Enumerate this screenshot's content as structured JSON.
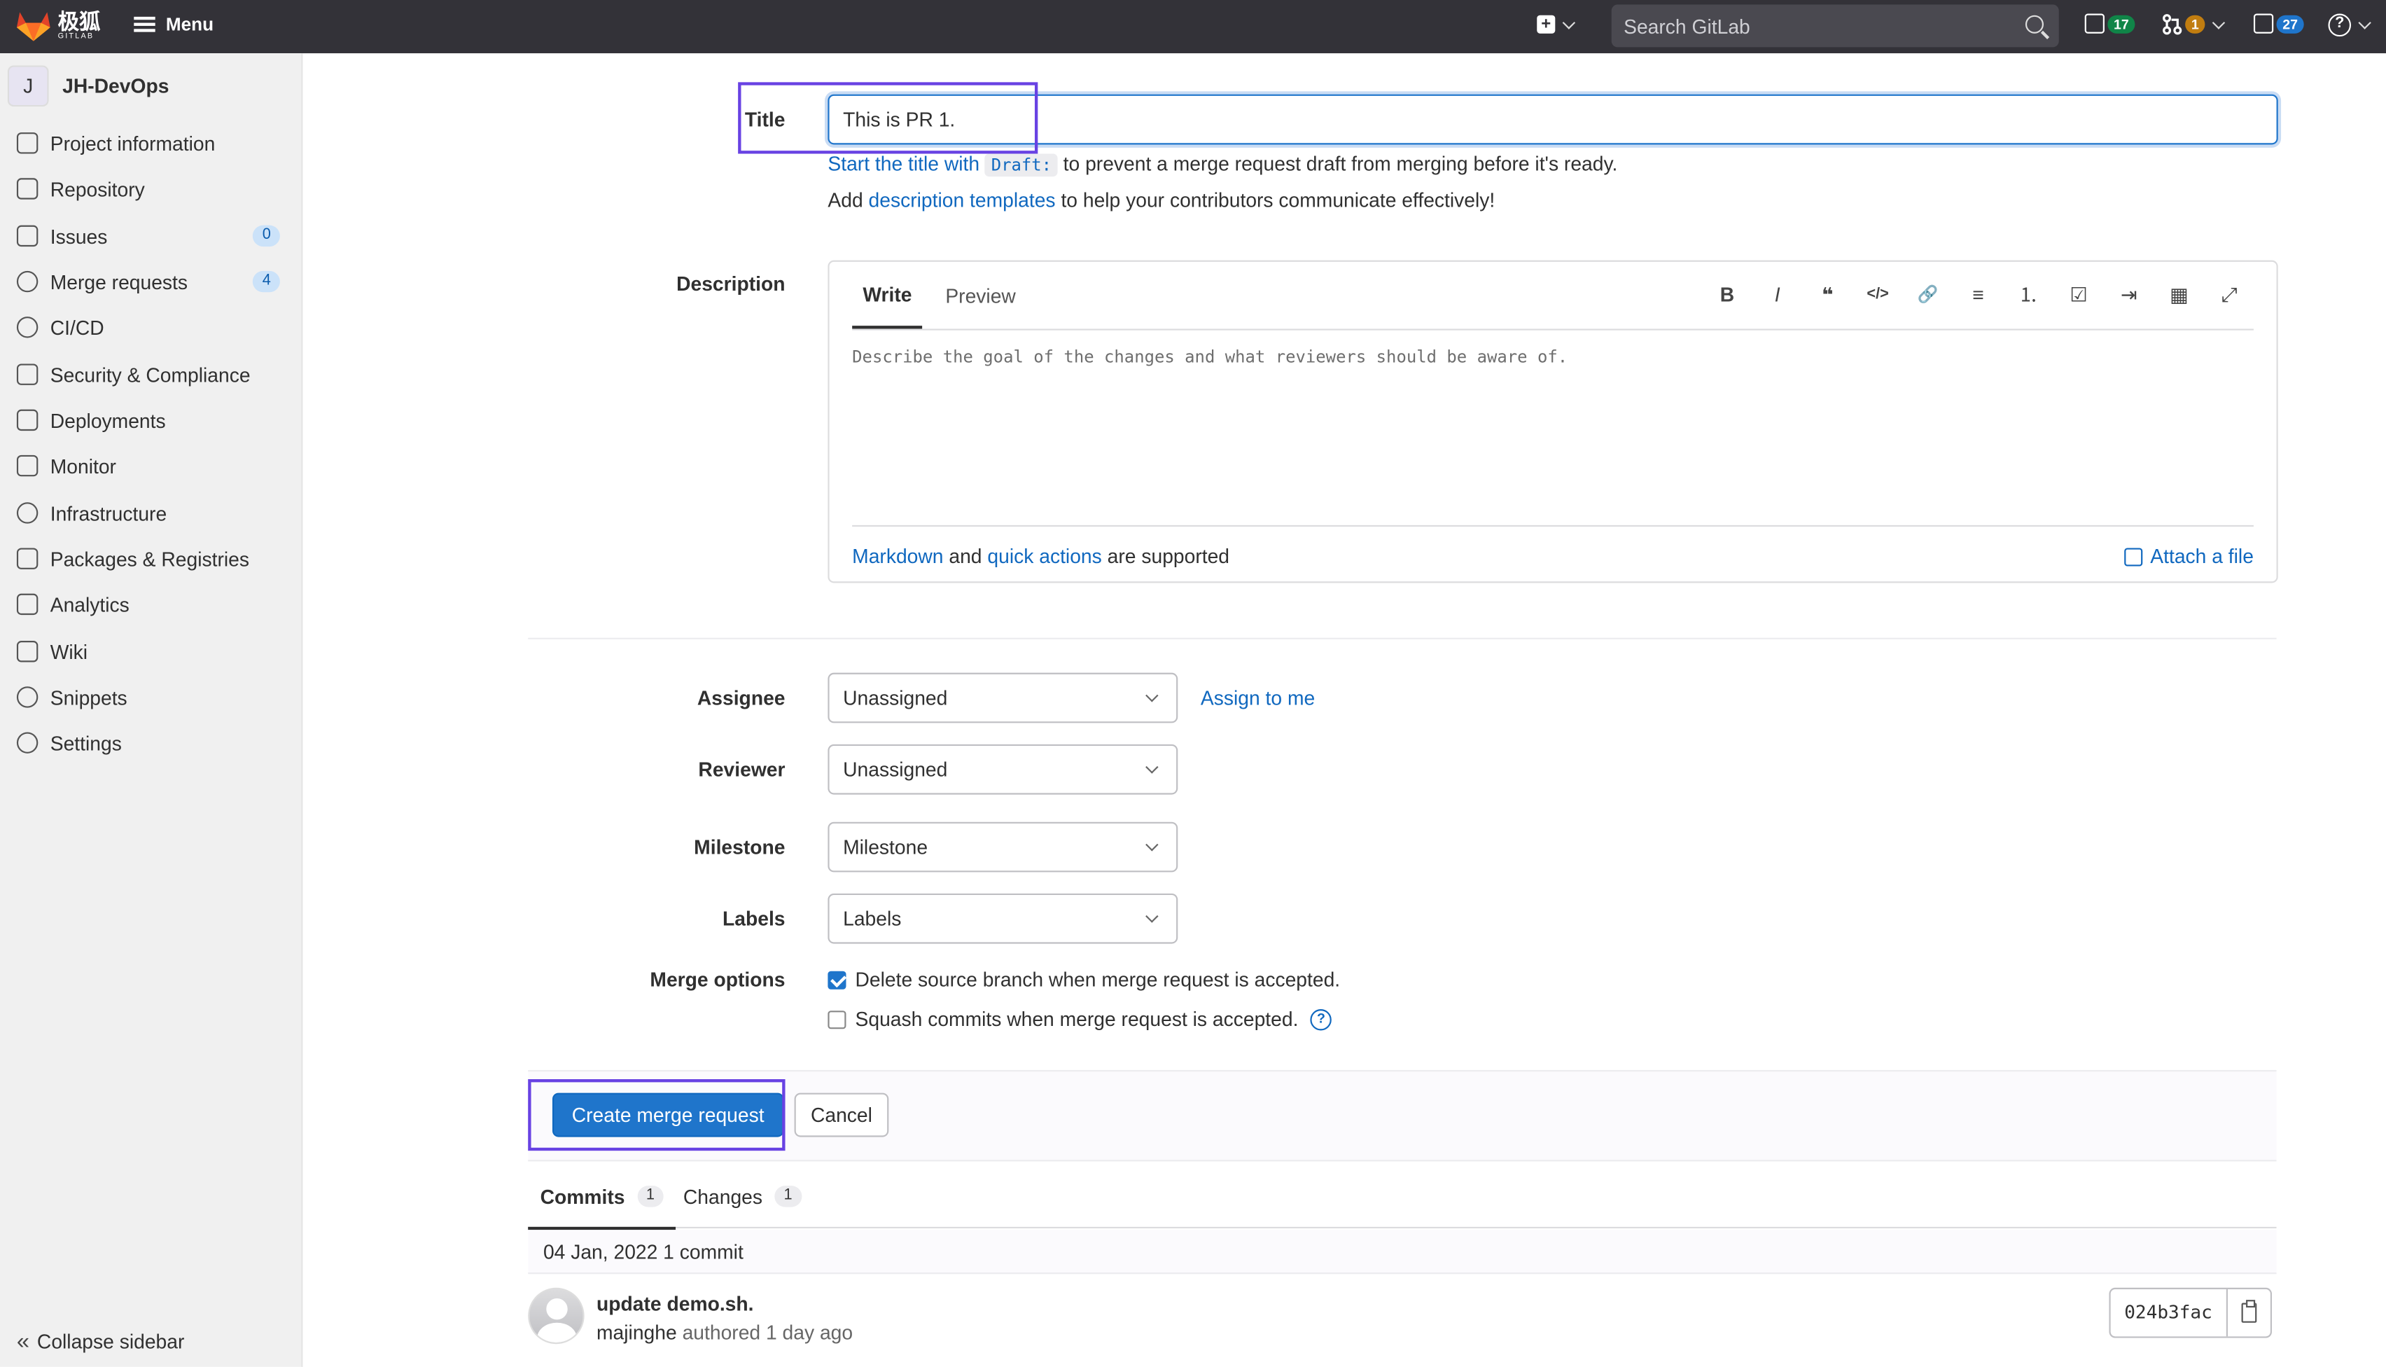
{
  "topbar": {
    "logo_text": "极狐",
    "logo_sub": "GITLAB",
    "menu_label": "Menu",
    "search_placeholder": "Search GitLab",
    "issues_count": "17",
    "mr_count": "1",
    "todos_count": "27",
    "help_glyph": "?"
  },
  "sidebar": {
    "project_initial": "J",
    "project_name": "JH-DevOps",
    "items": [
      {
        "label": "Project information",
        "icon": "project-icon"
      },
      {
        "label": "Repository",
        "icon": "repository-icon"
      },
      {
        "label": "Issues",
        "icon": "issues-icon",
        "count": "0"
      },
      {
        "label": "Merge requests",
        "icon": "merge-request-icon",
        "count": "4"
      },
      {
        "label": "CI/CD",
        "icon": "rocket-icon"
      },
      {
        "label": "Security & Compliance",
        "icon": "shield-icon"
      },
      {
        "label": "Deployments",
        "icon": "deployments-icon"
      },
      {
        "label": "Monitor",
        "icon": "monitor-icon"
      },
      {
        "label": "Infrastructure",
        "icon": "cloud-icon"
      },
      {
        "label": "Packages & Registries",
        "icon": "package-icon"
      },
      {
        "label": "Analytics",
        "icon": "chart-icon"
      },
      {
        "label": "Wiki",
        "icon": "book-icon"
      },
      {
        "label": "Snippets",
        "icon": "snippet-icon"
      },
      {
        "label": "Settings",
        "icon": "gear-icon"
      }
    ],
    "collapse_label": "Collapse sidebar",
    "collapse_glyph": "«"
  },
  "form": {
    "title_label": "Title",
    "title_value": "This is PR 1.",
    "help_start_link": "Start the title with",
    "help_draft_code": "Draft:",
    "help_start_rest": "to prevent a merge request draft from merging before it's ready.",
    "help_add": "Add",
    "help_templates_link": "description templates",
    "help_templates_rest": "to help your contributors communicate effectively!",
    "description_label": "Description",
    "tab_write": "Write",
    "tab_preview": "Preview",
    "toolbar": [
      "B",
      "I",
      "❝",
      "</>",
      "🔗",
      "≡",
      "⒈",
      "☑",
      "⇥",
      "▦",
      "⤢"
    ],
    "description_placeholder": "Describe the goal of the changes and what reviewers should be aware of.",
    "markdown_link": "Markdown",
    "and_text": "and",
    "quick_actions_link": "quick actions",
    "supported_text": "are supported",
    "attach_label": "Attach a file",
    "assignee_label": "Assignee",
    "assignee_value": "Unassigned",
    "assign_me": "Assign to me",
    "reviewer_label": "Reviewer",
    "reviewer_value": "Unassigned",
    "milestone_label": "Milestone",
    "milestone_value": "Milestone",
    "labels_label": "Labels",
    "labels_value": "Labels",
    "merge_options_label": "Merge options",
    "delete_branch_text": "Delete source branch when merge request is accepted.",
    "delete_branch_checked": true,
    "squash_text": "Squash commits when merge request is accepted.",
    "squash_checked": false,
    "help_glyph": "?",
    "create_button": "Create merge request",
    "cancel_button": "Cancel"
  },
  "commits": {
    "tab_commits": "Commits",
    "commits_count": "1",
    "tab_changes": "Changes",
    "changes_count": "1",
    "day_header": "04 Jan, 2022 1 commit",
    "commit_title": "update demo.sh.",
    "author": "majinghe",
    "authored_text": "authored 1 day ago",
    "sha": "024b3fac"
  },
  "colors": {
    "topbar_bg": "#333238",
    "primary": "#1f75cb",
    "link": "#1068bf",
    "highlight_box": "#6842e3"
  }
}
